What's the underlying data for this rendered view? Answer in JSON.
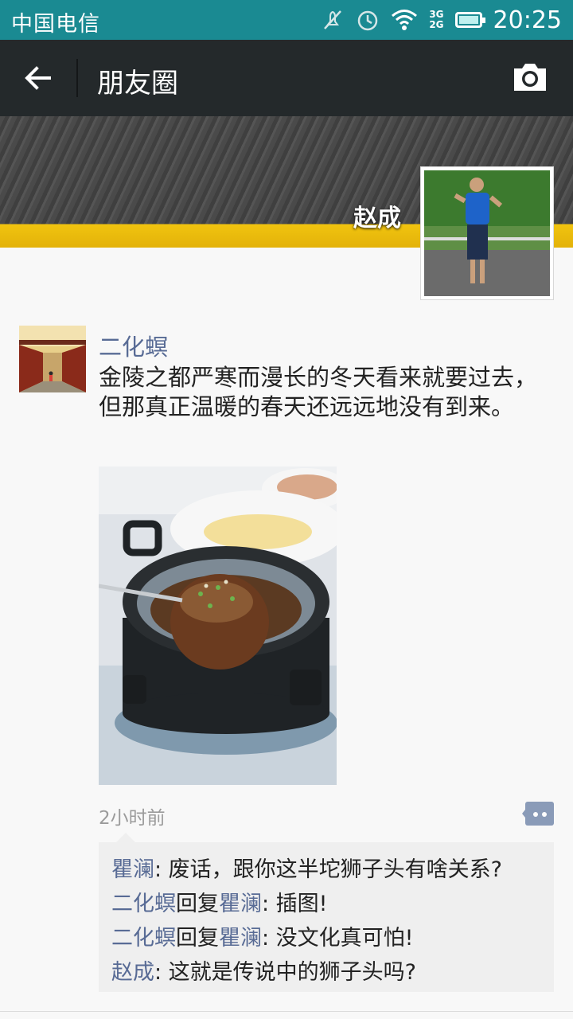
{
  "status_bar": {
    "carrier": "中国电信",
    "net_top": "3G",
    "net_bottom": "2G",
    "time": "20:25",
    "icons": [
      "mute-icon",
      "alarm-icon",
      "wifi-icon",
      "signal-icon",
      "battery-icon"
    ]
  },
  "header": {
    "title": "朋友圈",
    "back_icon": "back-arrow-icon",
    "camera_icon": "camera-icon"
  },
  "cover": {
    "owner_name": "赵成"
  },
  "post": {
    "author": "二化螟",
    "text": "金陵之都严寒而漫长的冬天看来就要过去，但那真正温暖的春天还远远地没有到来。",
    "time": "2小时前",
    "comments": [
      {
        "name": "瞿澜",
        "reply_word": "",
        "reply_to": "",
        "text": ": 废话，跟你这半坨狮子头有啥关系?"
      },
      {
        "name": "二化螟",
        "reply_word": "回复",
        "reply_to": "瞿澜",
        "text": ": 插图!"
      },
      {
        "name": "二化螟",
        "reply_word": "回复",
        "reply_to": "瞿澜",
        "text": ": 没文化真可怕!"
      },
      {
        "name": "赵成",
        "reply_word": "",
        "reply_to": "",
        "text": ": 这就是传说中的狮子头吗?"
      }
    ]
  },
  "colors": {
    "status_bar": "#1a8a92",
    "title_bar": "#24292b",
    "name_link": "#586b95",
    "comment_bg": "#efefef"
  }
}
